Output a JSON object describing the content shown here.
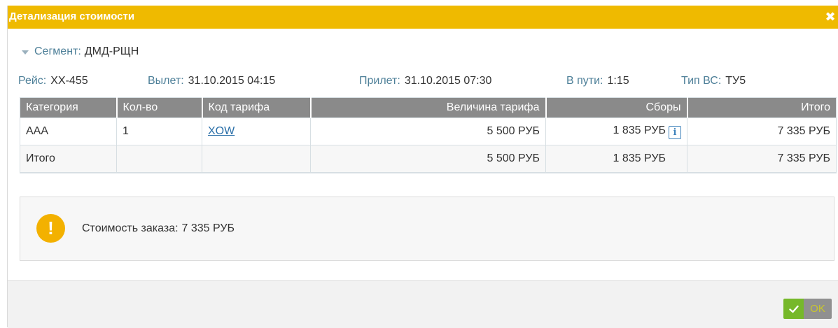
{
  "dialog": {
    "title": "Детализация стоимости",
    "close_icon": "close-icon",
    "colors": {
      "titlebar": "#efba00",
      "header_row": "#8a8a8a",
      "accent_link": "#2a6fa8",
      "warning": "#f3b100",
      "ok_green": "#76b82a"
    }
  },
  "segment": {
    "label": "Сегмент:",
    "value": "ДМД-РЩН",
    "icon": "caret-down-icon"
  },
  "flight": {
    "flight_label": "Рейс:",
    "flight_value": "XX-455",
    "departure_label": "Вылет:",
    "departure_value": "31.10.2015 04:15",
    "arrival_label": "Прилет:",
    "arrival_value": "31.10.2015 07:30",
    "duration_label": "В пути:",
    "duration_value": "1:15",
    "aircraft_label": "Тип ВС:",
    "aircraft_value": "ТУ5"
  },
  "table": {
    "headers": [
      "Категория",
      "Кол-во",
      "Код тарифа",
      "Величина тарифа",
      "Сборы",
      "Итого"
    ],
    "rows": [
      {
        "category": "AAA",
        "count": "1",
        "fare_code": "XOW",
        "fare_amount": "5 500 РУБ",
        "fees": "1 835 РУБ",
        "total": "7 335 РУБ",
        "fees_icon": "info-icon"
      }
    ],
    "totals": {
      "label": "Итого",
      "count": "",
      "fare_code": "",
      "fare_amount": "5 500 РУБ",
      "fees": "1 835 РУБ",
      "total": "7 335 РУБ"
    }
  },
  "notice": {
    "icon": "exclamation-icon",
    "label": "Стоимость заказа:",
    "value": "7 335 РУБ"
  },
  "footer": {
    "ok_label": "OK",
    "ok_icon": "checkmark-icon"
  }
}
